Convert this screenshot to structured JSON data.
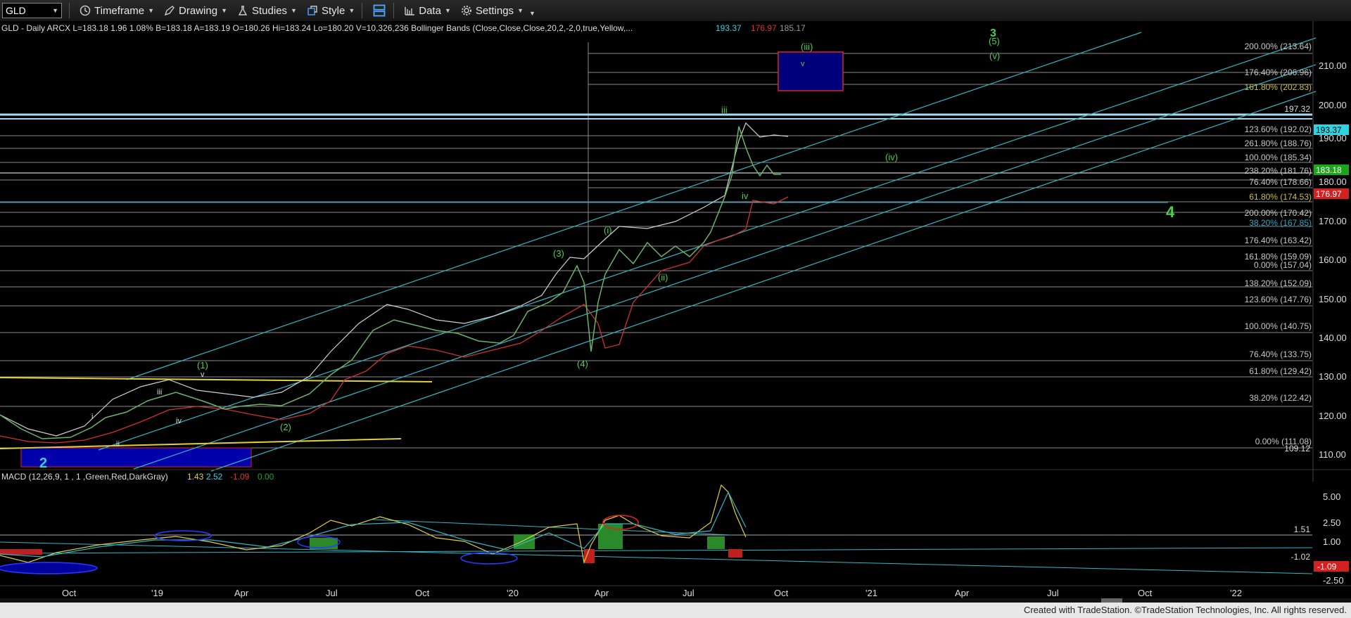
{
  "toolbar": {
    "symbol": "GLD",
    "timeframe_label": "Timeframe",
    "drawing_label": "Drawing",
    "studies_label": "Studies",
    "style_label": "Style",
    "data_label": "Data",
    "settings_label": "Settings",
    "icons": [
      "clock-icon",
      "pencil-icon",
      "flask-icon",
      "style-icon",
      "layout-icon",
      "bar-chart-icon",
      "gear-icon"
    ]
  },
  "header": {
    "symbol_line": "GLD - Daily  ARCX  L=183.18  1.96  1.08%  B=183.18  A=183.19  O=180.26  Hi=183.24  Lo=180.20  V=10,326,236  Bollinger Bands (Close,Close,Close,20,2,-2,0,true,Yellow,...",
    "bb_values": [
      "193.37",
      "176.97",
      "185.17"
    ],
    "macd_label": "MACD (12,26,9, 1 , 1 ,Green,Red,DarkGray)",
    "macd_values": [
      "1.43",
      "2.52",
      "-1.09",
      "0.00"
    ]
  },
  "price_axis": {
    "ticks": [
      "210.00",
      "200.00",
      "190.00",
      "180.00",
      "170.00",
      "160.00",
      "150.00",
      "140.00",
      "130.00",
      "120.00",
      "110.00"
    ],
    "tags": [
      {
        "text": "193.37",
        "color": "#2fd3e0"
      },
      {
        "text": "183.18",
        "color": "#1ea51e"
      },
      {
        "text": "176.97",
        "color": "#d32020"
      }
    ],
    "level_label": "197.32",
    "low_label": "109.12"
  },
  "macd_axis": {
    "ticks": [
      "5.00",
      "2.50",
      "1.00",
      "-2.50"
    ],
    "value_label": "1.51",
    "neg_label": "-1.02",
    "tag": "-1.09"
  },
  "fib_labels": [
    {
      "text": "200.00% (213.64)",
      "color": "#c8c8c8"
    },
    {
      "text": "176.40% (206.96)",
      "color": "#c8c8c8"
    },
    {
      "text": "161.80% (202.83)",
      "color": "#c8c040"
    },
    {
      "text": "123.60% (192.02)",
      "color": "#c8c8c8"
    },
    {
      "text": "261.80% (188.76)",
      "color": "#c8c8c8"
    },
    {
      "text": "100.00% (185.34)",
      "color": "#c8c8c8"
    },
    {
      "text": "238.20% (181.76)",
      "color": "#c8c8c8"
    },
    {
      "text": "76.40% (178.66)",
      "color": "#c8c8c8"
    },
    {
      "text": "61.80% (174.53)",
      "color": "#c8c040"
    },
    {
      "text": "200.00% (170.42)",
      "color": "#c8c8c8"
    },
    {
      "text": "38.20% (167.85)",
      "color": "#2fa8c8"
    },
    {
      "text": "176.40% (163.42)",
      "color": "#c8c8c8"
    },
    {
      "text": "161.80% (159.09)",
      "color": "#c8c8c8"
    },
    {
      "text": "0.00% (157.04)",
      "color": "#c8c8c8"
    },
    {
      "text": "138.20% (152.09)",
      "color": "#c8c8c8"
    },
    {
      "text": "123.60% (147.76)",
      "color": "#c8c8c8"
    },
    {
      "text": "100.00% (140.75)",
      "color": "#c8c8c8"
    },
    {
      "text": "76.40% (133.75)",
      "color": "#c8c8c8"
    },
    {
      "text": "61.80% (129.42)",
      "color": "#c8c8c8"
    },
    {
      "text": "38.20% (122.42)",
      "color": "#c8c8c8"
    },
    {
      "text": "0.00% (111.08)",
      "color": "#c8c8c8"
    }
  ],
  "wave_labels": [
    "(1)",
    "v",
    "i",
    "ii",
    "iii",
    "iv",
    "(2)",
    "(3)",
    "(4)",
    "(i)",
    "(ii)",
    "iii",
    "iv",
    "(iii)",
    "v",
    "(iv)",
    "3",
    "(5)",
    "(v)",
    "4",
    "2"
  ],
  "x_axis": [
    "Oct",
    "'19",
    "Apr",
    "Jul",
    "Oct",
    "'20",
    "Apr",
    "Jul",
    "Oct",
    "'21",
    "Apr",
    "Jul",
    "Oct",
    "'22"
  ],
  "footer": "Created with TradeStation. ©TradeStation Technologies, Inc. All rights reserved."
}
